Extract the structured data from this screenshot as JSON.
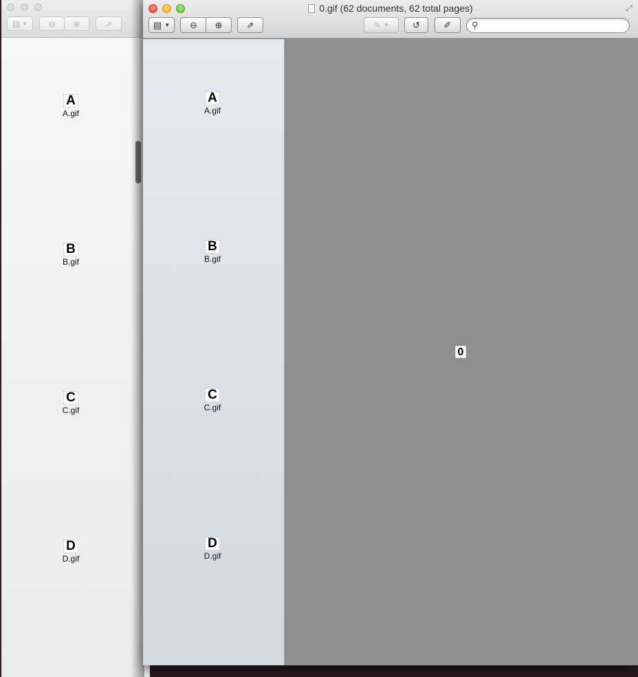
{
  "background_window": {
    "thumbnails": [
      {
        "letter": "A",
        "filename": "A.gif"
      },
      {
        "letter": "B",
        "filename": "B.gif"
      },
      {
        "letter": "C",
        "filename": "C.gif"
      },
      {
        "letter": "D",
        "filename": "D.gif"
      }
    ]
  },
  "main_window": {
    "title": "0.gif (62 documents, 62 total pages)",
    "search": {
      "value": "",
      "placeholder": ""
    },
    "thumbnails": [
      {
        "letter": "A",
        "filename": "A.gif"
      },
      {
        "letter": "B",
        "filename": "B.gif"
      },
      {
        "letter": "C",
        "filename": "C.gif"
      },
      {
        "letter": "D",
        "filename": "D.gif"
      }
    ],
    "current_page": {
      "text": "0"
    }
  },
  "icons": {
    "sidebar": "sidebar-toggle-icon",
    "zoom_out": "zoom-out-icon",
    "zoom_in": "zoom-in-icon",
    "share": "share-icon",
    "markup": "pen-icon",
    "rotate": "rotate-icon",
    "edit": "edit-icon",
    "search": "search-icon"
  }
}
